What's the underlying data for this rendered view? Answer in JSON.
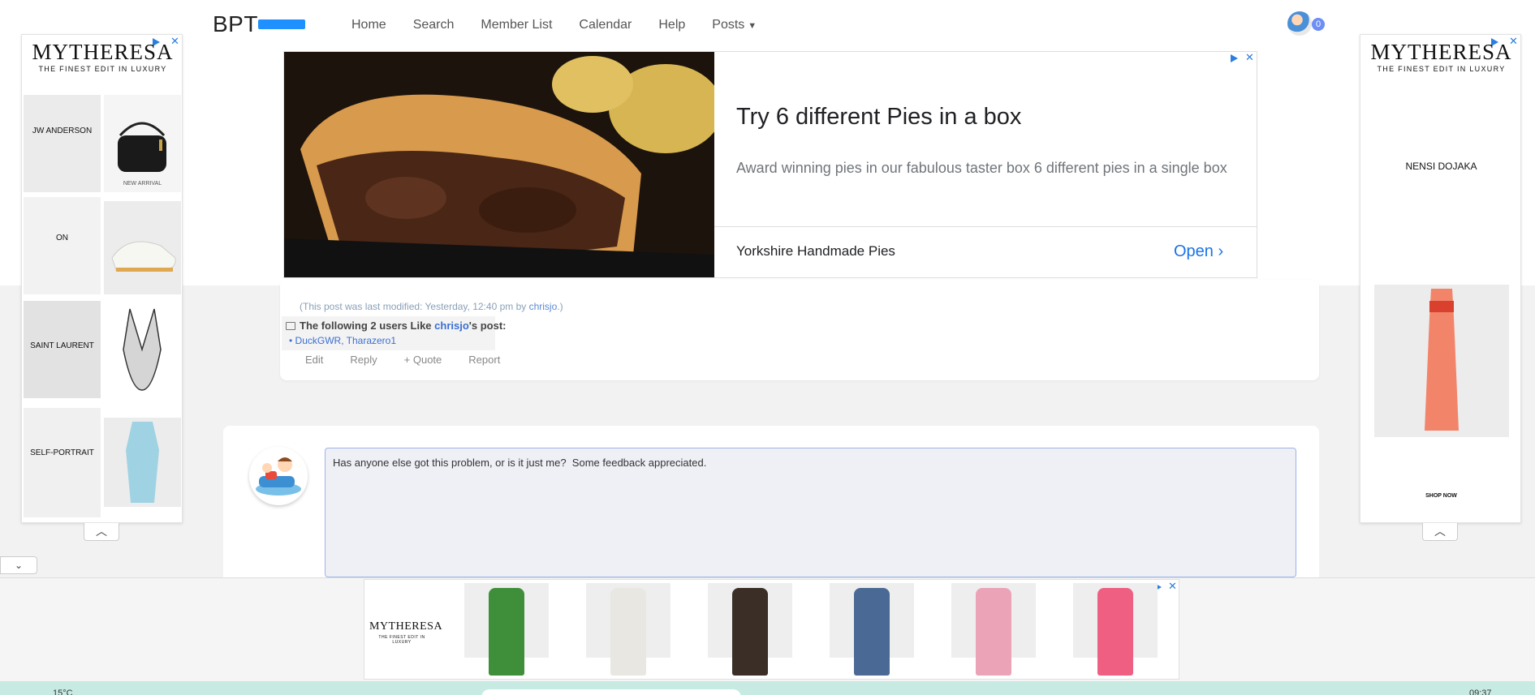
{
  "navbar": {
    "brand": "BPT",
    "items": [
      {
        "label": "Home"
      },
      {
        "label": "Search"
      },
      {
        "label": "Member List"
      },
      {
        "label": "Calendar"
      },
      {
        "label": "Help"
      },
      {
        "label": "Posts"
      }
    ],
    "notification_count": "0"
  },
  "post": {
    "mod_note_prefix": "(This post was last modified: Yesterday, 12:40 pm by ",
    "mod_note_user": "chrisjo",
    "mod_note_suffix": ".)",
    "likes_prefix": "The following 2 users Like ",
    "likes_user": "chrisjo",
    "likes_suffix": "'s post:",
    "likes_users": "• DuckGWR, Tharazero1",
    "actions": [
      "Edit",
      "Reply",
      "+ Quote",
      "Report"
    ]
  },
  "reply": {
    "text": "Has anyone else got this problem, or is it just me?  Some feedback appreciated."
  },
  "banner_ad": {
    "title": "Try 6 different Pies in a box",
    "description": "Award winning pies in our fabulous taster box 6 different pies in a single box",
    "advertiser": "Yorkshire Handmade Pies",
    "cta": "Open"
  },
  "side_ad_left": {
    "logo": "MYTHERESA",
    "tagline": "THE FINEST EDIT IN LUXURY",
    "tiles": [
      {
        "label": "JW ANDERSON",
        "sub": "NEW ARRIVAL"
      },
      {
        "label": "ON",
        "sub": ""
      },
      {
        "label": "SAINT LAURENT",
        "sub": ""
      },
      {
        "label": "SELF-PORTRAIT",
        "sub": ""
      }
    ]
  },
  "side_ad_right": {
    "logo": "MYTHERESA",
    "tagline": "THE FINEST EDIT IN LUXURY",
    "brand": "NENSI DOJAKA",
    "cta": "SHOP NOW"
  },
  "bottom_ad": {
    "logo": "MYTHERESA",
    "tagline": "THE FINEST EDIT IN LUXURY",
    "product_colors": [
      "#3f8f3a",
      "#e9e7e2",
      "#3a2e26",
      "#4a6a95",
      "#eba3b7",
      "#ee5f82"
    ]
  },
  "taskbar": {
    "weather": "15°C",
    "clock": "09:37"
  },
  "colors": {
    "accent": "#3b6fd1",
    "ad_blue": "#1a73e8",
    "taskbar": "#c7eae3"
  }
}
